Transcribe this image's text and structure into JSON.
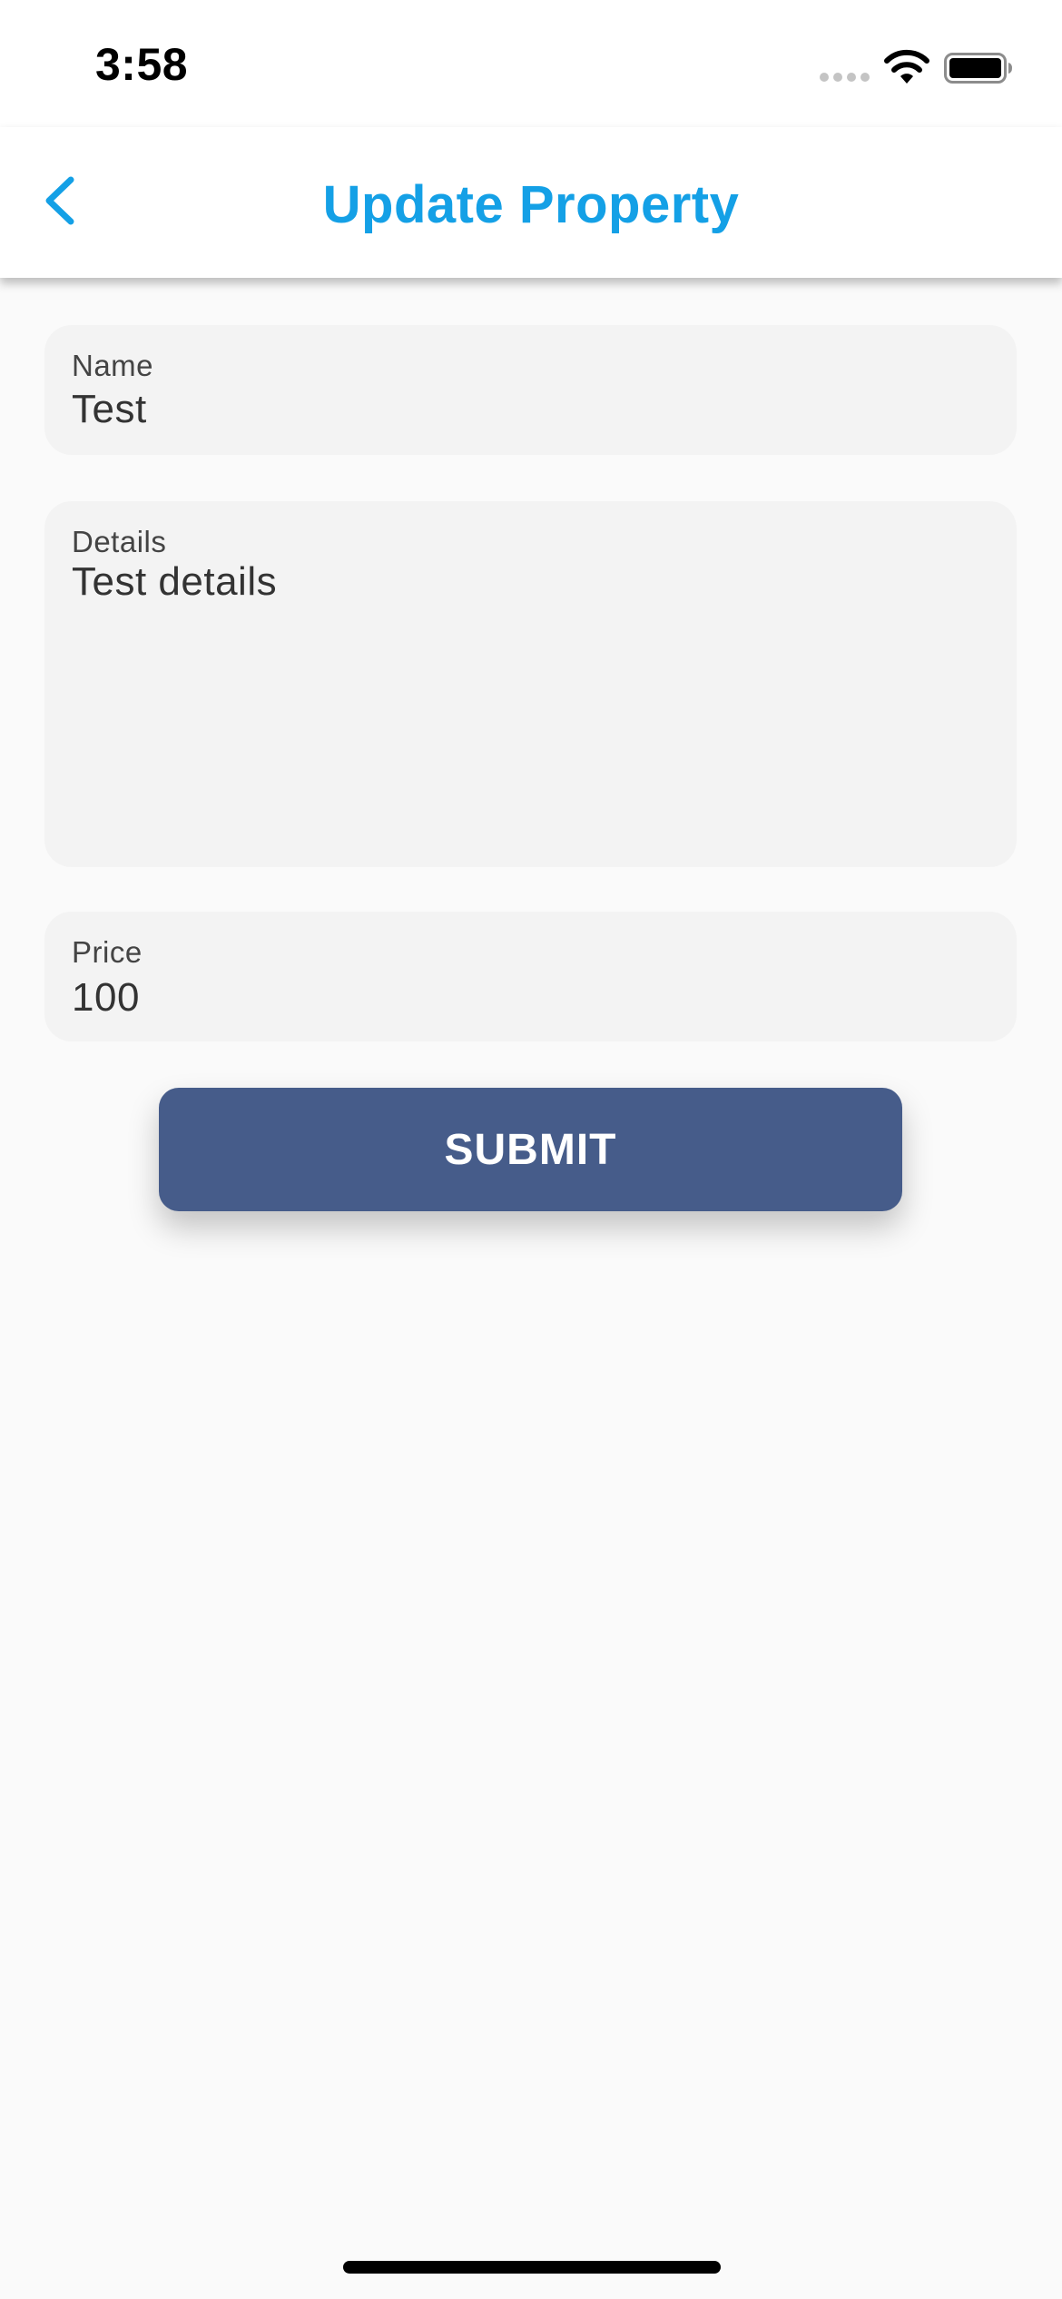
{
  "status_bar": {
    "time": "3:58",
    "icons": [
      "cellular-signal-icon",
      "wifi-icon",
      "battery-icon"
    ]
  },
  "header": {
    "title": "Update Property",
    "back_icon": "chevron-left-icon"
  },
  "form": {
    "name": {
      "label": "Name",
      "value": "Test"
    },
    "details": {
      "label": "Details",
      "value": "Test details"
    },
    "price": {
      "label": "Price",
      "value": "100"
    },
    "submit_label": "SUBMIT"
  },
  "colors": {
    "accent": "#14a0e6",
    "button": "#465c8a",
    "field_bg": "#f3f3f3",
    "page_bg": "#fafafa"
  }
}
